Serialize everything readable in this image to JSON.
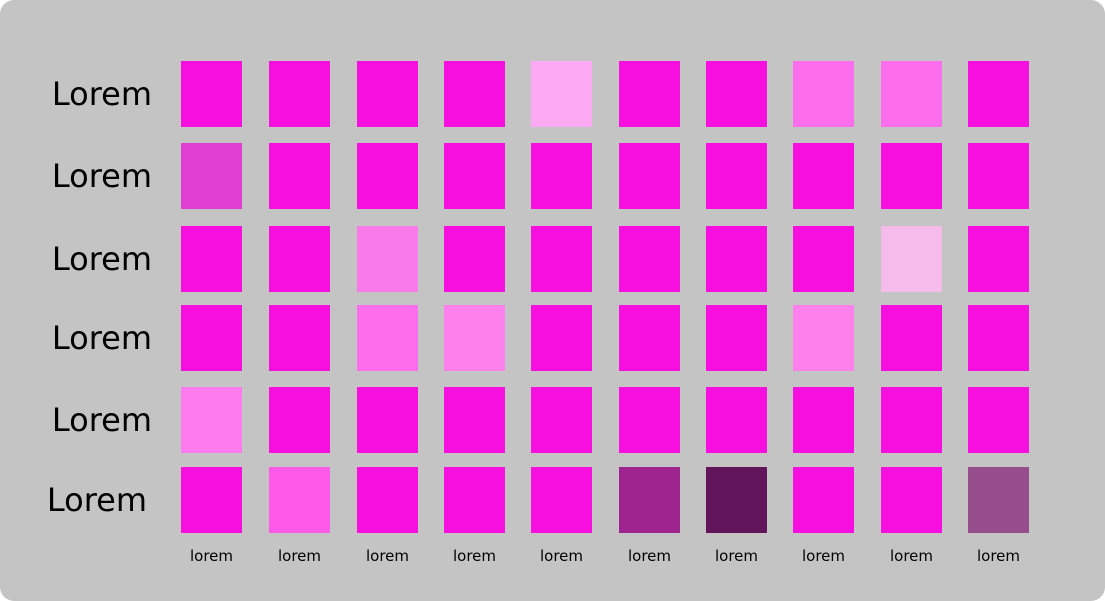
{
  "chart_data": {
    "type": "heatmap",
    "rows": [
      "Lorem",
      "Lorem",
      "Lorem",
      "Lorem",
      "Lorem",
      "Lorem"
    ],
    "columns": [
      "lorem",
      "lorem",
      "lorem",
      "lorem",
      "lorem",
      "lorem",
      "lorem",
      "lorem",
      "lorem",
      "lorem"
    ],
    "cell_colors": [
      [
        "#f60fde",
        "#f60fde",
        "#f60fde",
        "#f60fde",
        "#fea9f4",
        "#f60fde",
        "#f60fde",
        "#fd6eec",
        "#fd6eec",
        "#f60fde"
      ],
      [
        "#e13fd1",
        "#f60fde",
        "#f60fde",
        "#f60fde",
        "#f60fde",
        "#f60fde",
        "#f60fde",
        "#f60fde",
        "#f60fde",
        "#f60fde"
      ],
      [
        "#f60fde",
        "#f60fde",
        "#f87be9",
        "#f60fde",
        "#f60fde",
        "#f60fde",
        "#f60fde",
        "#f60fde",
        "#f5bbea",
        "#f60fde"
      ],
      [
        "#f60fde",
        "#f60fde",
        "#fd6eec",
        "#fd80ed",
        "#f60fde",
        "#f60fde",
        "#f60fde",
        "#fd80ed",
        "#f60fde",
        "#f60fde"
      ],
      [
        "#fd7bee",
        "#f60fde",
        "#f60fde",
        "#f60fde",
        "#f60fde",
        "#f60fde",
        "#f60fde",
        "#f60fde",
        "#f60fde",
        "#f60fde"
      ],
      [
        "#f60fde",
        "#fd5aea",
        "#f60fde",
        "#f60fde",
        "#f60fde",
        "#a0248f",
        "#62155a",
        "#f60fde",
        "#f60fde",
        "#954d8b"
      ]
    ]
  }
}
